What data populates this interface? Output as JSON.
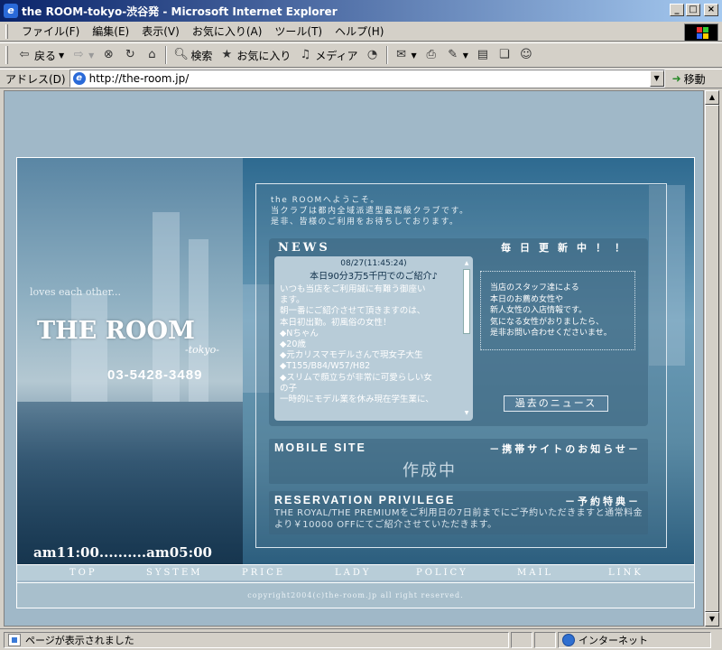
{
  "window": {
    "title": "the ROOM-tokyo-渋谷発 - Microsoft Internet Explorer",
    "app_icon": "ie-icon",
    "controls": [
      "minimize-icon",
      "maximize-icon",
      "close-icon"
    ]
  },
  "menu": {
    "items": [
      "ファイル(F)",
      "編集(E)",
      "表示(V)",
      "お気に入り(A)",
      "ツール(T)",
      "ヘルプ(H)"
    ]
  },
  "toolbar": {
    "back_label": "戻る",
    "search_label": "検索",
    "favorites_label": "お気に入り",
    "media_label": "メディア"
  },
  "address": {
    "label": "アドレス(D)",
    "url": "http://the-room.jp/",
    "go_label": "移動"
  },
  "site": {
    "tagline": "loves each other...",
    "logo": "THE ROOM",
    "logo_sub": "-tokyo-",
    "phone": "03-5428-3489",
    "hours": "am11:00..........am05:00",
    "welcome": [
      "the ROOMへようこそ。",
      "当クラブは都内全域派遣型最高級クラブです。",
      "是非、皆様のご利用をお待ちしております。"
    ],
    "news": {
      "title": "NEWS",
      "daily": "毎日更新中！！",
      "date": "08/27(11:45:24)",
      "heading": "本日90分3万5千円でのご紹介♪",
      "body": [
        "いつも当店をご利用誠に有難う御座い",
        "ます。",
        "朝一番にご紹介させて頂きますのは、",
        "本日初出勤。初風俗の女性！",
        "◆Nちゃん",
        "◆20歳",
        "◆元カリスマモデルさんで現女子大生",
        "◆T155/B84/W57/H82",
        "◆スリムで顔立ちが非常に可愛らしい女",
        "の子",
        "一時的にモデル業を休み現在学生業に、"
      ],
      "staff_info": [
        "当店のスタッフ達による",
        "本日のお薦め女性や",
        "新人女性の入店情報です。",
        "気になる女性がおりましたら、",
        "是非お問い合わせくださいませ。"
      ],
      "past_news_label": "過去のニュース"
    },
    "mobile": {
      "title": "MOBILE SITE",
      "subtitle": "－携帯サイトのお知らせ－",
      "status": "作成中"
    },
    "reservation": {
      "title": "RESERVATION PRIVILEGE",
      "subtitle": "－予約特典－",
      "text": "THE ROYAL/THE PREMIUMをご利用日の7日前までにご予約いただきますと通常料金より￥10000 OFFにてご紹介させていただきます。"
    },
    "nav": [
      "TOP",
      "SYSTEM",
      "PRICE",
      "LADY",
      "POLICY",
      "MAIL",
      "LINK"
    ],
    "copyright": "copyright2004(c)the-room.jp all right reserved."
  },
  "status": {
    "message": "ページが表示されました",
    "zone": "インターネット"
  }
}
